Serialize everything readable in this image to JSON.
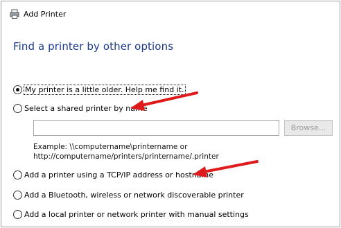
{
  "window": {
    "title": "Add Printer",
    "icon": "printer-icon"
  },
  "page": {
    "heading": "Find a printer by other options"
  },
  "options": [
    {
      "label": "My printer is a little older. Help me find it.",
      "checked": true
    },
    {
      "label": "Select a shared printer by name",
      "checked": false
    },
    {
      "label": "Add a printer using a TCP/IP address or hostname",
      "checked": false
    },
    {
      "label": "Add a Bluetooth, wireless or network discoverable printer",
      "checked": false
    },
    {
      "label": "Add a local printer or network printer with manual settings",
      "checked": false
    }
  ],
  "shared_printer": {
    "input_value": "",
    "browse_label": "Browse...",
    "example_line1": "Example: \\\\computername\\printername or",
    "example_line2": "http://computername/printers/printername/.printer"
  },
  "colors": {
    "heading": "#1e3a8a",
    "annotation_arrow": "#e01b1b"
  }
}
